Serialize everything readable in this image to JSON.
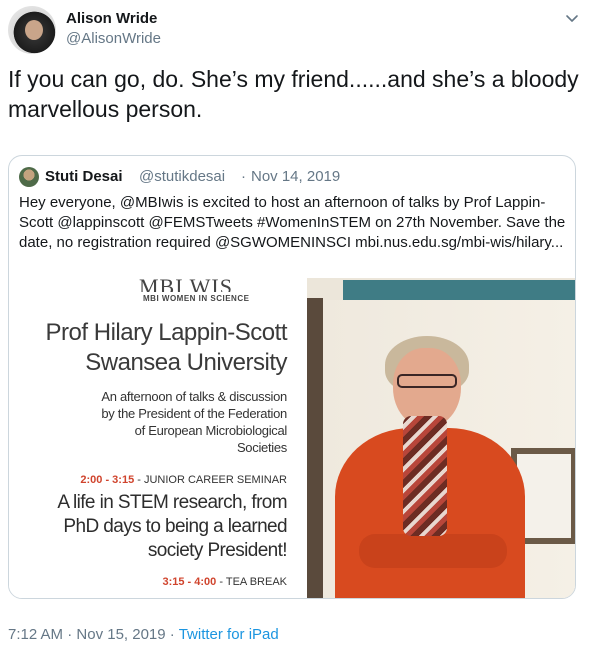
{
  "author": {
    "name": "Alison Wride",
    "handle": "@AlisonWride"
  },
  "tweet": {
    "text": "If you can go, do. She’s my friend......and she’s a bloody marvellous person."
  },
  "quoted": {
    "name": "Stuti Desai",
    "handle": "@stutikdesai",
    "separator": "·",
    "date": "Nov 14, 2019",
    "text": "Hey everyone, @MBIwis is excited to host an afternoon of talks by Prof Lappin-Scott @lappinscott @FEMSTweets #WomenInSTEM on 27th November. Save the date, no registration required @SGWOMENINSCI mbi.nus.edu.sg/mbi-wis/hilary..."
  },
  "poster": {
    "logo": "MBI WIS",
    "logo_sub": "MBI WOMEN IN SCIENCE",
    "title_line1": "Prof Hilary Lappin-Scott",
    "title_line2": "Swansea University",
    "description": "An afternoon of talks & discussion\nby the President of the Federation\nof European Microbiological\nSocieties",
    "slot1_time": "2:00 - 3:15",
    "slot1_label": " - JUNIOR CAREER SEMINAR",
    "talk_title": "A life in STEM research, from\nPhD days to being a learned\nsociety President!",
    "slot2_time": "3:15 - 4:00",
    "slot2_label": " - TEA BREAK"
  },
  "footer": {
    "time": "7:12 AM",
    "separator1": " · ",
    "date": "Nov 15, 2019",
    "separator2": " · ",
    "source": "Twitter for iPad"
  },
  "colors": {
    "text": "#14171a",
    "secondary": "#657786",
    "link": "#1b95e0",
    "border": "#ccd6dd",
    "poster_accent": "#d0442d"
  },
  "icons": {
    "chevron": "chevron-down-icon"
  }
}
